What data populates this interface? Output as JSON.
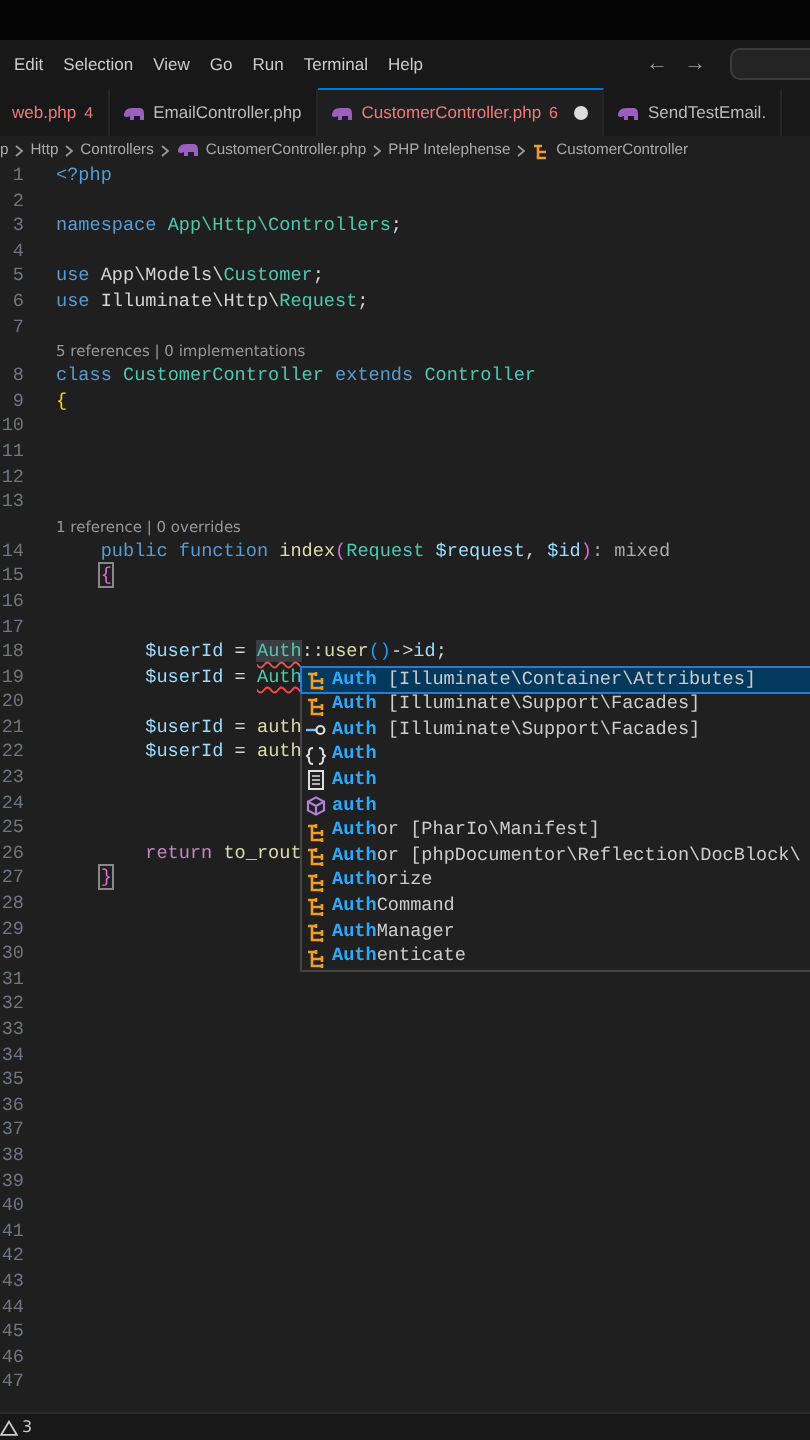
{
  "menu": [
    "Edit",
    "Selection",
    "View",
    "Go",
    "Run",
    "Terminal",
    "Help"
  ],
  "nav": {
    "back": "←",
    "forward": "→"
  },
  "tabs": [
    {
      "label": "web.php",
      "badge": "4",
      "error": true,
      "modified": false,
      "selected": false
    },
    {
      "label": "EmailController.php",
      "error": false,
      "modified": false,
      "selected": false
    },
    {
      "label": "CustomerController.php",
      "badge": "6",
      "error": true,
      "modified": true,
      "selected": true
    },
    {
      "label": "SendTestEmail.",
      "error": false,
      "modified": false,
      "selected": false
    }
  ],
  "breadcrumb": [
    {
      "label": "p",
      "kind": "folder"
    },
    {
      "label": "Http",
      "kind": "folder"
    },
    {
      "label": "Controllers",
      "kind": "folder"
    },
    {
      "label": "CustomerController.php",
      "kind": "php"
    },
    {
      "label": "PHP Intelephense",
      "kind": "folder"
    },
    {
      "label": "CustomerController",
      "kind": "class"
    }
  ],
  "lines": [
    {
      "kind": "code",
      "n": "1",
      "tokens": [
        {
          "t": "<?php",
          "kind": "keyword"
        }
      ]
    },
    {
      "kind": "code",
      "n": "2"
    },
    {
      "kind": "code",
      "n": "3",
      "tokens": [
        {
          "t": "namespace",
          "kind": "keyword"
        },
        {
          "t": " App\\Http\\Controllers",
          "kind": "type"
        },
        {
          "t": ";",
          "kind": "plain"
        }
      ]
    },
    {
      "kind": "code",
      "n": "4"
    },
    {
      "kind": "code",
      "n": "5",
      "tokens": [
        {
          "t": "use",
          "kind": "keyword"
        },
        {
          "t": " App\\Models\\",
          "kind": "plain"
        },
        {
          "t": "Customer",
          "kind": "type"
        },
        {
          "t": ";",
          "kind": "plain"
        }
      ]
    },
    {
      "kind": "code",
      "n": "6",
      "tokens": [
        {
          "t": "use",
          "kind": "keyword"
        },
        {
          "t": " Illuminate\\Http\\",
          "kind": "plain"
        },
        {
          "t": "Request",
          "kind": "type"
        },
        {
          "t": ";",
          "kind": "plain"
        }
      ]
    },
    {
      "kind": "code",
      "n": "7"
    },
    {
      "kind": "lens",
      "text": "5 references | 0 implementations"
    },
    {
      "kind": "code",
      "n": "8",
      "tokens": [
        {
          "t": "class",
          "kind": "keyword"
        },
        {
          "t": " CustomerController",
          "kind": "type"
        },
        {
          "t": " extends",
          "kind": "keyword"
        },
        {
          "t": " Controller",
          "kind": "type"
        }
      ]
    },
    {
      "kind": "code",
      "n": "9",
      "tokens": [
        {
          "t": "{",
          "kind": "brace"
        }
      ]
    },
    {
      "kind": "code",
      "n": "10"
    },
    {
      "kind": "code",
      "n": "11"
    },
    {
      "kind": "code",
      "n": "12"
    },
    {
      "kind": "code",
      "n": "13"
    },
    {
      "kind": "lens",
      "text": "1 reference | 0 overrides"
    },
    {
      "kind": "code",
      "n": "14",
      "tokens": [
        {
          "t": "    public",
          "kind": "keyword"
        },
        {
          "t": " function",
          "kind": "keyword"
        },
        {
          "t": " index",
          "kind": "function"
        },
        {
          "t": "(",
          "kind": "paren"
        },
        {
          "t": "Request",
          "kind": "type"
        },
        {
          "t": " $request",
          "kind": "variable"
        },
        {
          "t": ",",
          "kind": "plain"
        },
        {
          "t": " $id",
          "kind": "variable"
        },
        {
          "t": ")",
          "kind": "paren"
        },
        {
          "t": ": mixed",
          "kind": "hint"
        }
      ]
    },
    {
      "kind": "code",
      "n": "15",
      "tokens": [
        {
          "t": "    {",
          "kind": "match"
        }
      ]
    },
    {
      "kind": "code",
      "n": "16"
    },
    {
      "kind": "code",
      "n": "17"
    },
    {
      "kind": "code",
      "n": "18",
      "tokens": [
        {
          "t": "        $userId",
          "kind": "variable"
        },
        {
          "t": " =",
          "kind": "plain"
        },
        {
          "t": " Auth",
          "kind": "type",
          "error": true,
          "highlight": true
        },
        {
          "t": "::",
          "kind": "plain"
        },
        {
          "t": "user",
          "kind": "function"
        },
        {
          "t": "()",
          "kind": "call"
        },
        {
          "t": "->",
          "kind": "plain"
        },
        {
          "t": "id",
          "kind": "variable"
        },
        {
          "t": ";",
          "kind": "plain"
        }
      ]
    },
    {
      "kind": "code",
      "n": "19",
      "tokens": [
        {
          "t": "        $userId",
          "kind": "variable"
        },
        {
          "t": " =",
          "kind": "plain"
        },
        {
          "t": " Auth",
          "kind": "type",
          "error": true
        }
      ],
      "suggest": true
    },
    {
      "kind": "code",
      "n": "20"
    },
    {
      "kind": "code",
      "n": "21",
      "tokens": [
        {
          "t": "        $userId",
          "kind": "variable"
        },
        {
          "t": " =",
          "kind": "plain"
        },
        {
          "t": " auth",
          "kind": "function"
        }
      ]
    },
    {
      "kind": "code",
      "n": "22",
      "tokens": [
        {
          "t": "        $userId",
          "kind": "variable"
        },
        {
          "t": " =",
          "kind": "plain"
        },
        {
          "t": " auth",
          "kind": "function"
        }
      ]
    },
    {
      "kind": "code",
      "n": "23"
    },
    {
      "kind": "code",
      "n": "24"
    },
    {
      "kind": "code",
      "n": "25"
    },
    {
      "kind": "code",
      "n": "26",
      "tokens": [
        {
          "t": "        return",
          "kind": "control"
        },
        {
          "t": " to_rout",
          "kind": "function"
        }
      ]
    },
    {
      "kind": "code",
      "n": "27",
      "tokens": [
        {
          "t": "    }",
          "kind": "match"
        }
      ]
    },
    {
      "kind": "code",
      "n": "28"
    },
    {
      "kind": "code",
      "n": "29"
    },
    {
      "kind": "code",
      "n": "30"
    },
    {
      "kind": "code",
      "n": "31"
    },
    {
      "kind": "code",
      "n": "32"
    },
    {
      "kind": "code",
      "n": "33"
    },
    {
      "kind": "code",
      "n": "34"
    },
    {
      "kind": "code",
      "n": "35"
    },
    {
      "kind": "code",
      "n": "36"
    },
    {
      "kind": "code",
      "n": "37"
    },
    {
      "kind": "code",
      "n": "38"
    },
    {
      "kind": "code",
      "n": "39"
    },
    {
      "kind": "code",
      "n": "40"
    },
    {
      "kind": "code",
      "n": "41"
    },
    {
      "kind": "code",
      "n": "42"
    },
    {
      "kind": "code",
      "n": "43"
    },
    {
      "kind": "code",
      "n": "44"
    },
    {
      "kind": "code",
      "n": "45"
    },
    {
      "kind": "code",
      "n": "46"
    },
    {
      "kind": "code",
      "n": "47"
    }
  ],
  "suggestions": [
    {
      "kind": "class",
      "match": "Auth",
      "detail": "[Illuminate\\Container\\Attributes]",
      "selected": true
    },
    {
      "kind": "class",
      "match": "Auth",
      "detail": "[Illuminate\\Support\\Facades]",
      "selected": false
    },
    {
      "kind": "interface",
      "match": "Auth",
      "detail": "[Illuminate\\Support\\Facades]",
      "selected": false
    },
    {
      "kind": "namespace",
      "match": "Auth",
      "selected": false
    },
    {
      "kind": "file",
      "match": "Auth",
      "selected": false
    },
    {
      "kind": "function",
      "match": "auth",
      "selected": false
    },
    {
      "kind": "class",
      "match": "Auth",
      "rest": "or",
      "detail": "[PharIo\\Manifest]",
      "selected": false
    },
    {
      "kind": "class",
      "match": "Auth",
      "rest": "or",
      "detail": "[phpDocumentor\\Reflection\\DocBlock\\",
      "selected": false
    },
    {
      "kind": "class",
      "match": "Auth",
      "rest": "orize",
      "selected": false
    },
    {
      "kind": "class",
      "match": "Auth",
      "rest": "Command",
      "selected": false
    },
    {
      "kind": "class",
      "match": "Auth",
      "rest": "Manager",
      "selected": false
    },
    {
      "kind": "class",
      "match": "Auth",
      "rest": "enticate",
      "selected": false
    }
  ],
  "status_bar": {
    "warnings": "3"
  }
}
